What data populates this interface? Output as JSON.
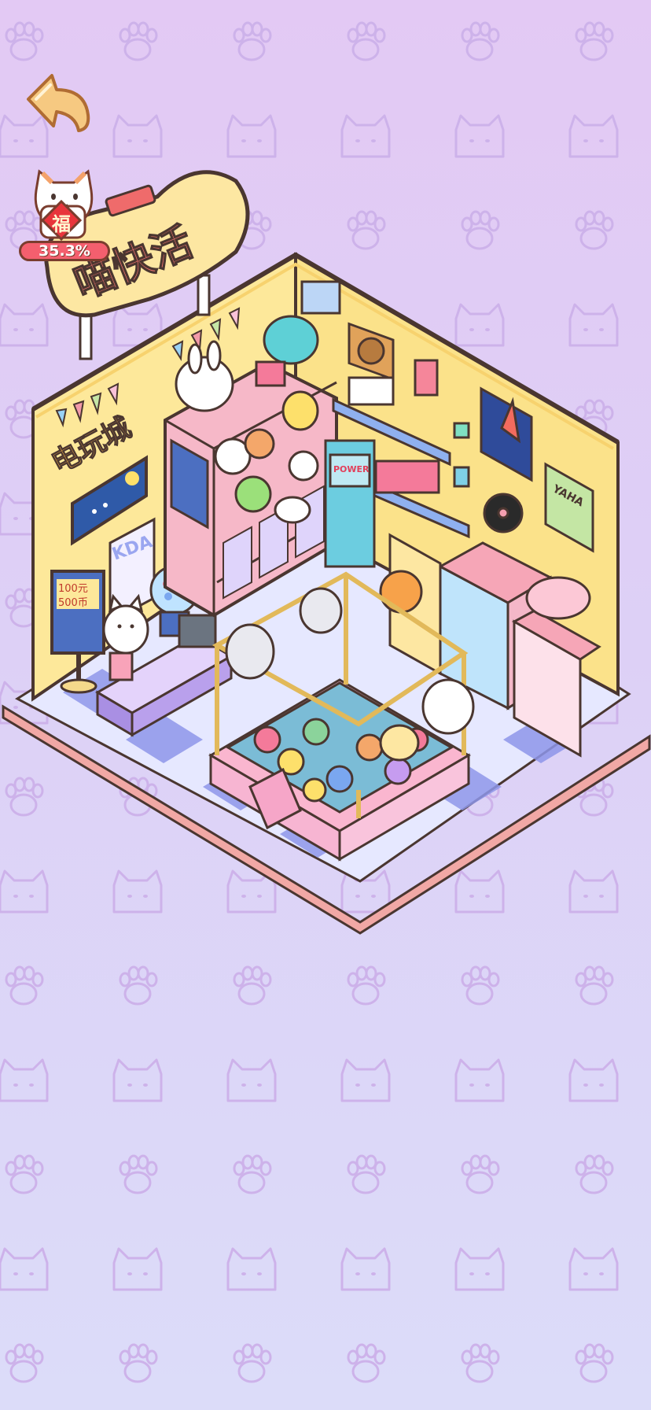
{
  "store": {
    "sign_title": "喵快活",
    "wall_sign": "电玩城",
    "poster_text": "YAHA",
    "price_sign_line1": "100元",
    "price_sign_line2": "500币",
    "arcade_label": "KDA",
    "machine_label": "POWER"
  },
  "fortune": {
    "char": "福",
    "percent": "35.3%"
  },
  "icons": {
    "back": "back-arrow-icon",
    "fortune": "lucky-cat-icon"
  },
  "colors": {
    "bg_top": "#e3c9f4",
    "bg_bottom": "#dcdcf9",
    "wall": "#fde89a",
    "floor_light": "#e6e8ff",
    "floor_dark": "#8e96ea",
    "base": "#f7bfbd",
    "outline": "#4a3630"
  }
}
